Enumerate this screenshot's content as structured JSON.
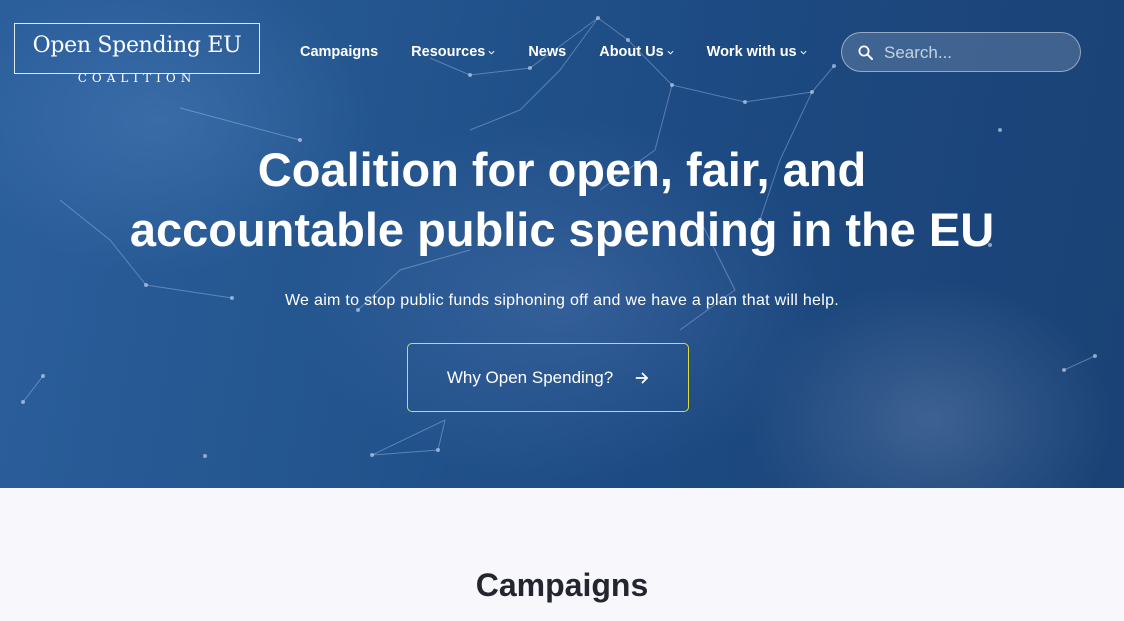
{
  "header": {
    "logo_title": "Open Spending EU",
    "logo_subtitle": "COALITION",
    "nav": [
      {
        "label": "Campaigns",
        "dropdown": false
      },
      {
        "label": "Resources",
        "dropdown": true
      },
      {
        "label": "News",
        "dropdown": false
      },
      {
        "label": "About Us",
        "dropdown": true
      },
      {
        "label": "Work with us",
        "dropdown": true
      }
    ],
    "search": {
      "placeholder": "Search...",
      "value": "",
      "icon": "search-icon"
    }
  },
  "hero": {
    "title_line1": "Coalition for open, fair, and",
    "title_line2": "accountable public spending in the EU",
    "subtitle": "We aim to stop public funds siphoning off and we have a plan that will help.",
    "cta_label": "Why Open Spending?",
    "cta_icon": "arrow-right-icon",
    "cta_border_color": "#d8df3c"
  },
  "main": {
    "section_title": "Campaigns"
  },
  "colors": {
    "hero_blue": "#1d4a82",
    "page_bg": "#f7f7fc",
    "heading_dark": "#23252f"
  }
}
